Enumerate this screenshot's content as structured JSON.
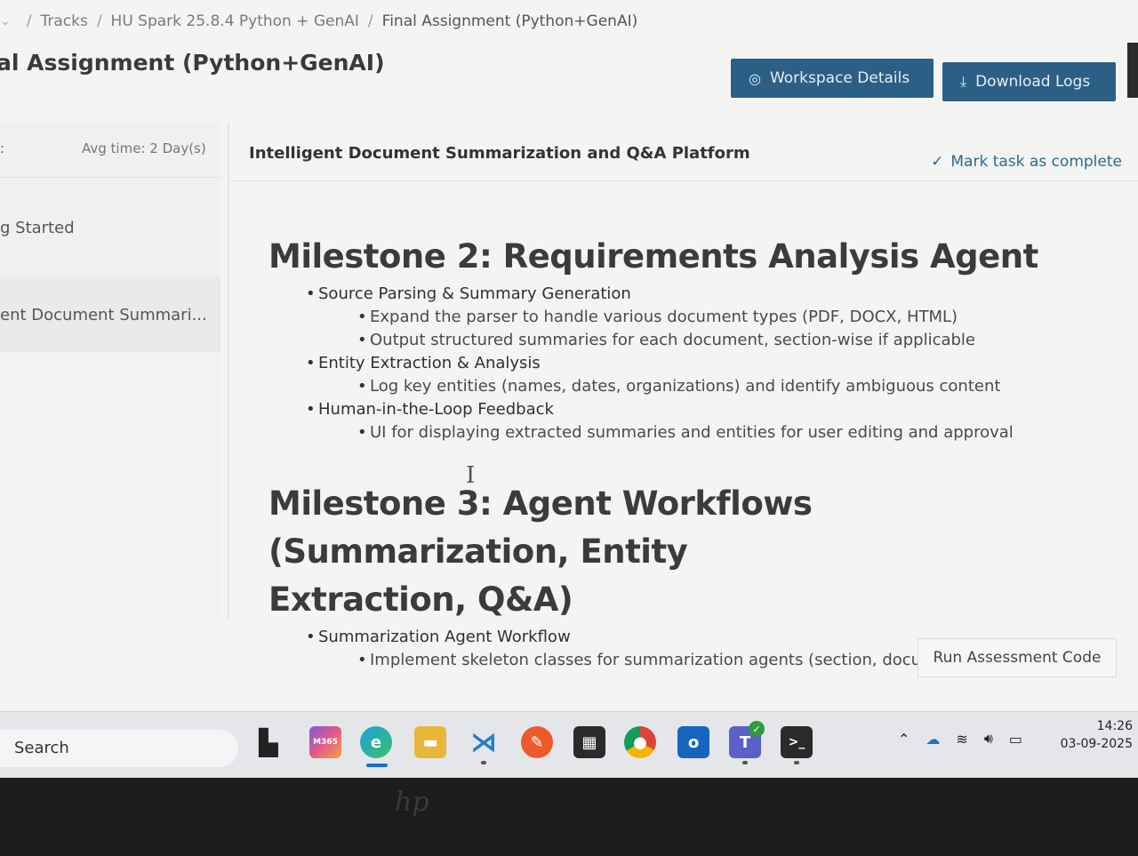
{
  "breadcrumb": {
    "items": [
      "Tracks",
      "HU Spark 25.8.4 Python + GenAI",
      "Final Assignment (Python+GenAI)"
    ]
  },
  "page": {
    "title": "al Assignment (Python+GenAI)"
  },
  "actions": {
    "workspace_label": "Workspace Details",
    "download_label": "Download Logs"
  },
  "sidebar": {
    "avg_time": "Avg time: 2 Day(s)",
    "items": [
      {
        "label": "g Started"
      },
      {
        "label": "ent Document Summari..."
      }
    ]
  },
  "task": {
    "title": "Intelligent Document Summarization and Q&A Platform",
    "mark_complete": "Mark task as complete"
  },
  "content": {
    "milestone2": {
      "title": "Milestone 2: Requirements Analysis Agent",
      "sections": [
        {
          "heading": "Source Parsing & Summary Generation",
          "bullets": [
            "Expand the parser to handle various document types (PDF, DOCX, HTML)",
            "Output structured summaries for each document, section-wise if applicable"
          ]
        },
        {
          "heading": "Entity Extraction & Analysis",
          "bullets": [
            "Log key entities (names, dates, organizations) and identify ambiguous content"
          ]
        },
        {
          "heading": "Human-in-the-Loop Feedback",
          "bullets": [
            "UI for displaying extracted summaries and entities for user editing and approval"
          ]
        }
      ]
    },
    "milestone3": {
      "title_line1": "Milestone 3: Agent Workflows (Summarization, Entity",
      "title_line2": "Extraction, Q&A)",
      "sections": [
        {
          "heading": "Summarization Agent Workflow",
          "bullets": [
            "Implement skeleton classes for summarization agents (section, document, corpus-level)"
          ]
        }
      ]
    }
  },
  "run_button": "Run Assessment Code",
  "taskbar": {
    "search_label": "Search",
    "m365_label": "M365",
    "clock_time": "14:26",
    "clock_date": "03-09-2025"
  },
  "colors": {
    "primary_button": "#2b5f86",
    "accent_text": "#2d6a90"
  }
}
